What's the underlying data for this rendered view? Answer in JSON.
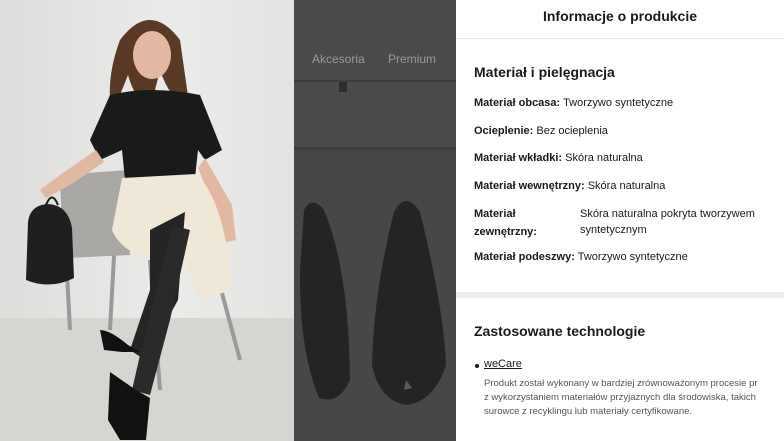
{
  "gallery": {
    "nav": [
      "Akcesoria",
      "Premium"
    ]
  },
  "panel": {
    "title": "Informacje o produkcie",
    "material_section_title": "Materiał i pielęgnacja",
    "attributes": [
      {
        "label": "Materiał obcasa:",
        "value": "Tworzywo syntetyczne"
      },
      {
        "label": "Ocieplenie:",
        "value": "Bez ocieplenia"
      },
      {
        "label": "Materiał wkładki:",
        "value": "Skóra naturalna"
      },
      {
        "label": "Materiał wewnętrzny:",
        "value": "Skóra naturalna"
      },
      {
        "label": "Materiał zewnętrzny:",
        "value": "Skóra naturalna pokryta tworzywem syntetycznym"
      },
      {
        "label": "Materiał podeszwy:",
        "value": "Tworzywo syntetyczne"
      }
    ],
    "tech_section_title": "Zastosowane technologie",
    "tech_link": "weCare",
    "tech_description": [
      "Produkt został wykonany w bardziej zrównoważonym procesie pr",
      "z wykorzystaniem materiałów przyjaznych dla środowiska, takich",
      "surowce z recyklingu lub materiały certyfikowane."
    ]
  },
  "colors": {
    "overlay": "#3d3d3d",
    "text": "#1a1a1a"
  }
}
